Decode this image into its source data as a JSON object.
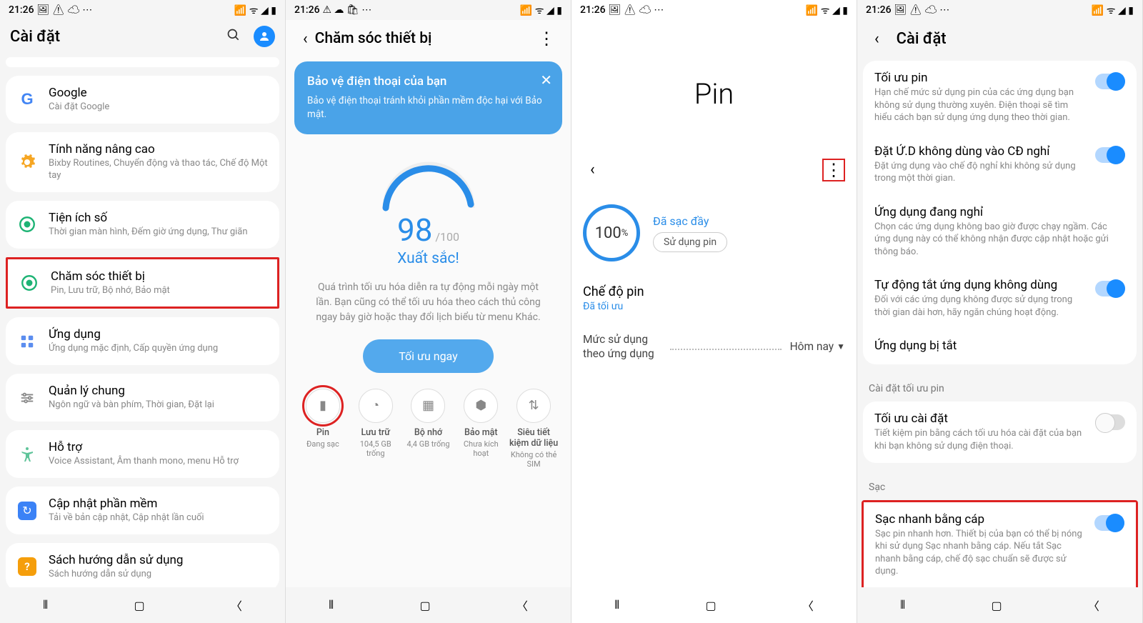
{
  "status": {
    "time": "21:26",
    "icons_left": "🖼 ⚠ ☁ ⋯",
    "icons_right": "📶 ᯤ ◢ ▮"
  },
  "p1": {
    "title": "Cài đặt",
    "items": [
      {
        "title": "Google",
        "sub": "Cài đặt Google",
        "icon": "G",
        "color": "#4285f4"
      },
      {
        "title": "Tính năng nâng cao",
        "sub": "Bixby Routines, Chuyển động và thao tác, Chế độ Một tay",
        "icon": "gear",
        "color": "#f6a623"
      },
      {
        "title": "Tiện ích số",
        "sub": "Thời gian màn hình, Đếm giờ ứng dụng, Thư giãn",
        "icon": "wellbeing",
        "color": "#1db374"
      },
      {
        "title": "Chăm sóc thiết bị",
        "sub": "Pin, Lưu trữ, Bộ nhớ, Bảo mật",
        "icon": "care",
        "color": "#1db374",
        "boxed": true
      },
      {
        "title": "Ứng dụng",
        "sub": "Ứng dụng mặc định, Cấp quyền ứng dụng",
        "icon": "apps",
        "color": "#5b8def"
      },
      {
        "title": "Quản lý chung",
        "sub": "Ngôn ngữ và bàn phím, Thời gian, Đặt lại",
        "icon": "sliders",
        "color": "#888"
      },
      {
        "title": "Hỗ trợ",
        "sub": "Voice Assistant, Âm thanh mono, menu Hỗ trợ",
        "icon": "access",
        "color": "#5fc49a"
      },
      {
        "title": "Cập nhật phần mềm",
        "sub": "Tải về bản cập nhật, Cập nhật lần cuối",
        "icon": "update",
        "color": "#3b82f6"
      },
      {
        "title": "Sách hướng dẫn sử dụng",
        "sub": "Sách hướng dẫn sử dụng",
        "icon": "manual",
        "color": "#f59e0b"
      }
    ]
  },
  "p2": {
    "title": "Chăm sóc thiết bị",
    "banner": {
      "title": "Bảo vệ điện thoại của bạn",
      "text": "Bảo vệ điện thoại tránh khỏi phần mềm độc hại với Bảo mật."
    },
    "score": "98",
    "score_max": "/100",
    "score_label": "Xuất sắc!",
    "desc": "Quá trình tối ưu hóa diễn ra tự động mỗi ngày một lần. Bạn cũng có thể tối ưu hóa theo cách thủ công ngay bây giờ hoặc thay đổi lịch biểu từ menu Khác.",
    "btn": "Tối ưu ngay",
    "shortcuts": [
      {
        "label": "Pin",
        "sub": "Đang sạc",
        "boxed": true,
        "glyph": "▮"
      },
      {
        "label": "Lưu trữ",
        "sub": "104,5 GB trống",
        "glyph": "◔"
      },
      {
        "label": "Bộ nhớ",
        "sub": "4,4 GB trống",
        "glyph": "▦"
      },
      {
        "label": "Bảo mật",
        "sub": "Chưa kích hoạt",
        "glyph": "⬢"
      },
      {
        "label": "Siêu tiết kiệm dữ liệu",
        "sub": "Không có thẻ SIM",
        "glyph": "⇅"
      }
    ]
  },
  "p3": {
    "title": "Pin",
    "pct": "100",
    "pct_unit": "%",
    "status": "Đã sạc đầy",
    "chip": "Sử dụng pin",
    "mode_title": "Chế độ pin",
    "mode_val": "Đã tối ưu",
    "usage_label": "Mức sử dụng theo ứng dụng",
    "today": "Hôm nay"
  },
  "p4": {
    "title": "Cài đặt",
    "g1": [
      {
        "title": "Tối ưu pin",
        "sub": "Hạn chế mức sử dụng pin của các ứng dụng bạn không sử dụng thường xuyên. Điện thoại sẽ tìm hiểu cách bạn sử dụng ứng dụng theo thời gian.",
        "on": true
      },
      {
        "title": "Đặt Ứ.D không dùng vào CĐ nghỉ",
        "sub": "Đặt ứng dụng vào chế độ nghỉ khi không sử dụng trong một thời gian.",
        "on": true
      },
      {
        "title": "Ứng dụng đang nghỉ",
        "sub": "Chọn các ứng dụng không bao giờ được chạy ngầm. Các ứng dụng này có thể không nhận được cập nhật hoặc gửi thông báo."
      },
      {
        "title": "Tự động tắt ứng dụng không dùng",
        "sub": "Đối với các ứng dụng không được sử dụng trong thời gian dài hơn, hãy ngăn chúng hoạt động.",
        "on": true
      },
      {
        "title": "Ứng dụng bị tắt",
        "sub": ""
      }
    ],
    "section1": "Cài đặt tối ưu pin",
    "g2": [
      {
        "title": "Tối ưu cài đặt",
        "sub": "Tiết kiệm pin bằng cách tối ưu hóa cài đặt của bạn khi bạn không sử dụng điện thoại.",
        "on": false
      }
    ],
    "section2": "Sạc",
    "g3": [
      {
        "title": "Sạc nhanh bằng cáp",
        "sub": "Sạc pin nhanh hơn. Thiết bị của bạn có thể bị nóng khi sử dụng Sạc nhanh bằng cáp. Nếu tắt Sạc nhanh bằng cáp, chế độ sạc chuẩn sẽ được sử dụng.",
        "on": true
      }
    ]
  }
}
